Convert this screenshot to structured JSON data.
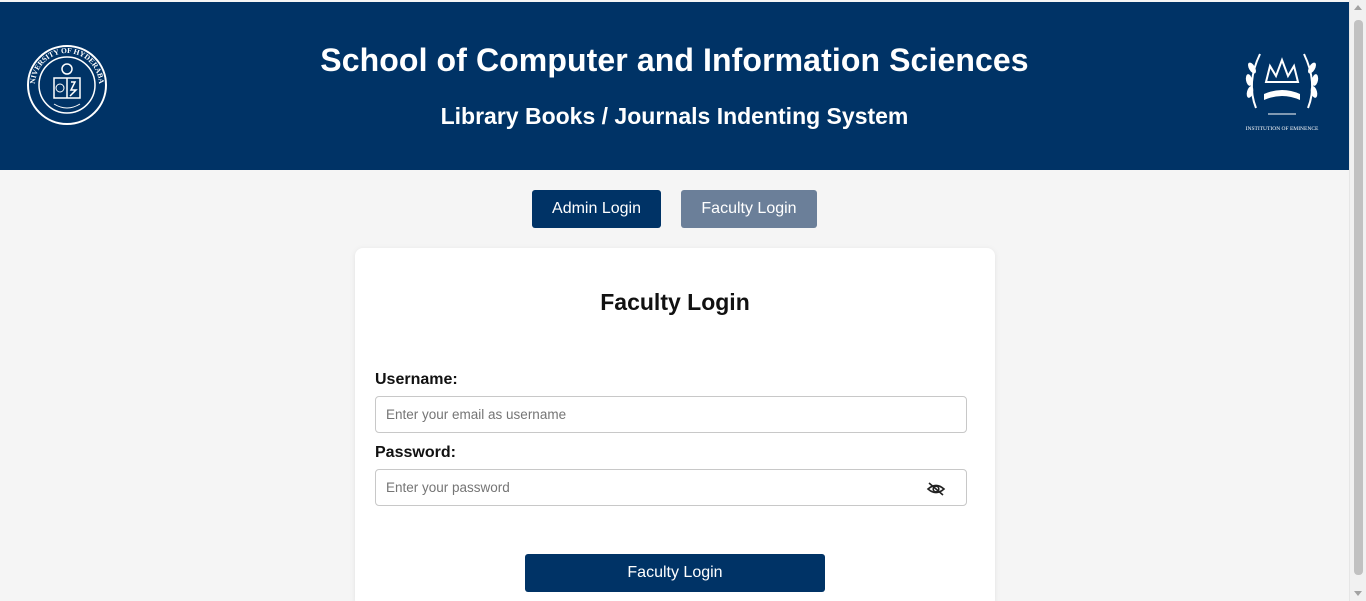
{
  "header": {
    "title": "School of Computer and Information Sciences",
    "subtitle": "Library Books / Journals Indenting System",
    "left_logo_name": "university-of-hyderabad-seal",
    "right_logo_name": "institution-of-eminence-emblem",
    "right_logo_text": "INSTITUTION OF EMINENCE",
    "left_logo_text": "UNIVERSITY OF HYDERABAD",
    "background_color": "#003366"
  },
  "tabs": {
    "admin_label": "Admin Login",
    "faculty_label": "Faculty Login",
    "active": "faculty"
  },
  "form": {
    "title": "Faculty Login",
    "username_label": "Username:",
    "username_placeholder": "Enter your email as username",
    "username_value": "",
    "password_label": "Password:",
    "password_placeholder": "Enter your password",
    "password_value": "",
    "password_toggle_icon": "eye-slash-icon",
    "submit_label": "Faculty Login"
  },
  "colors": {
    "primary": "#003366",
    "inactive_tab": "#6b7f99",
    "page_background": "#f5f5f5"
  }
}
